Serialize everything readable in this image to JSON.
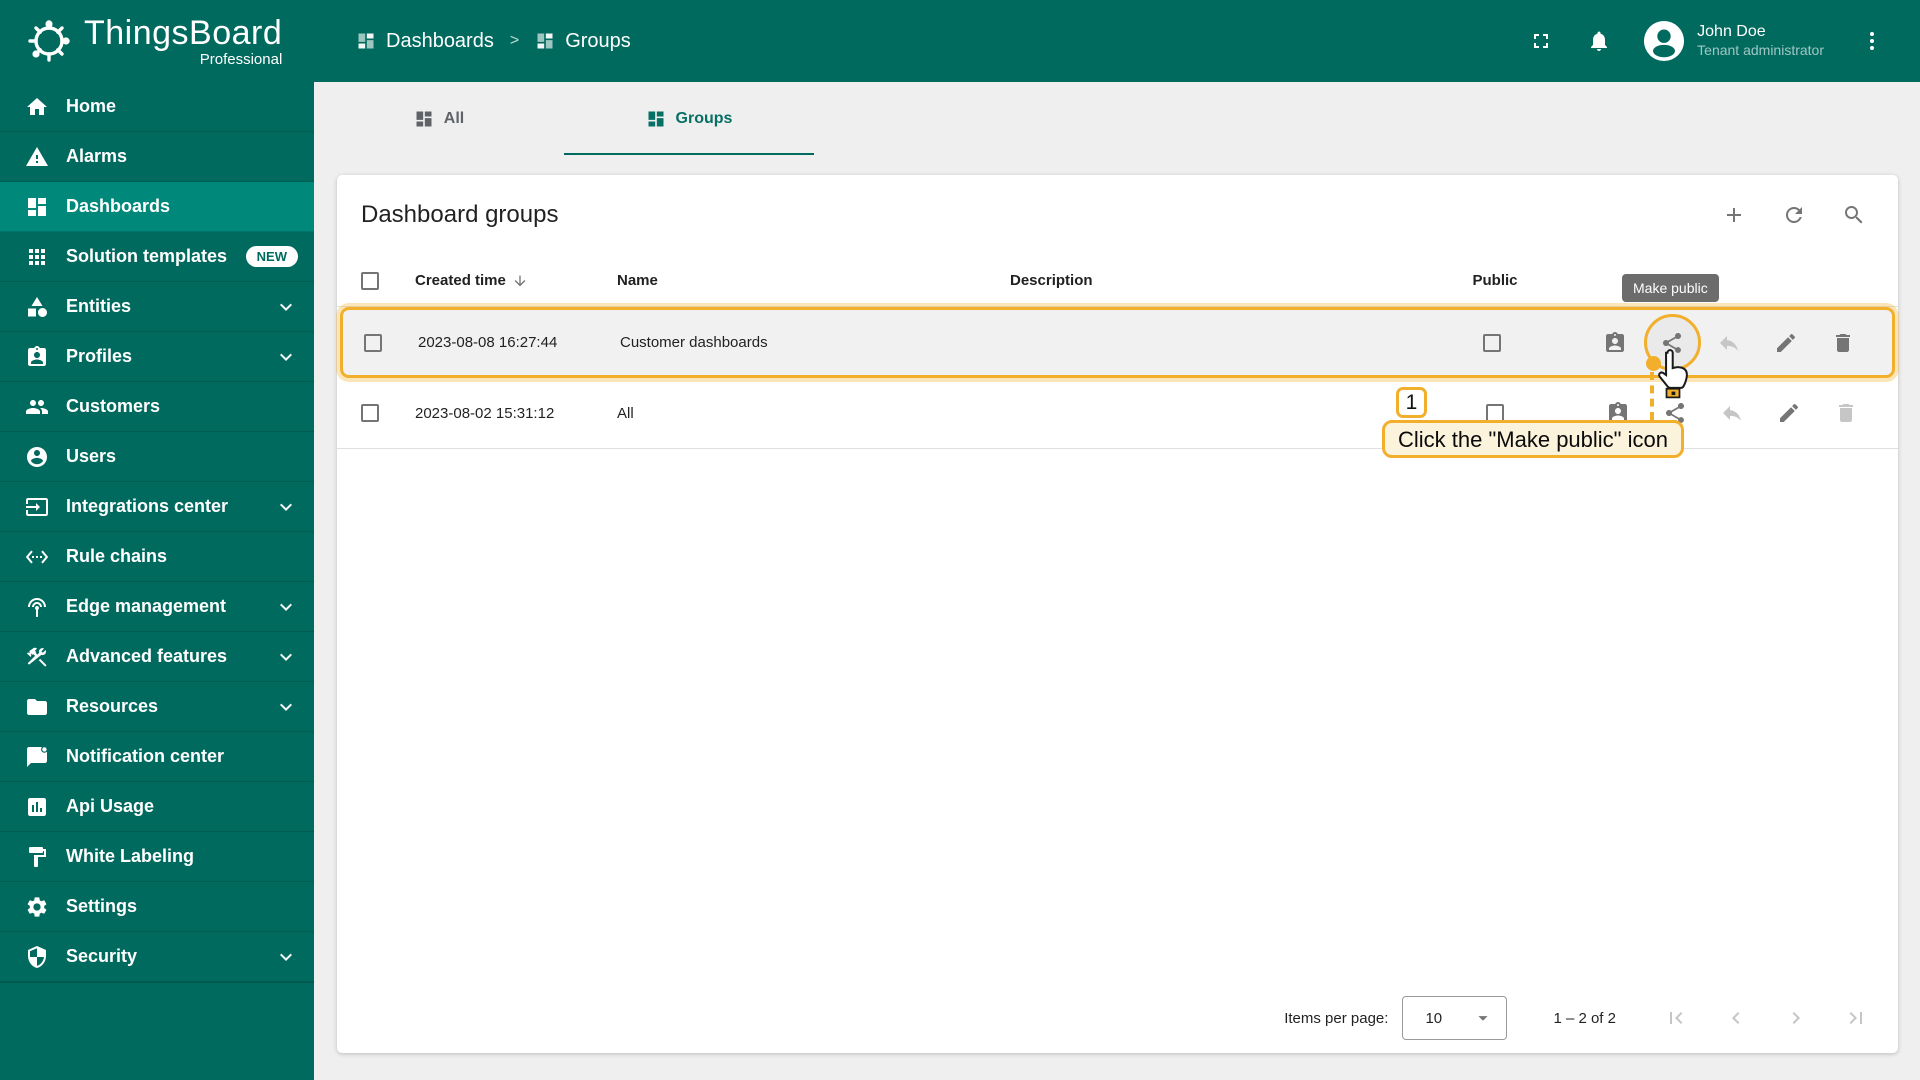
{
  "brand": {
    "name": "ThingsBoard",
    "subtitle": "Professional"
  },
  "breadcrumb": {
    "items": [
      {
        "label": "Dashboards"
      },
      {
        "label": "Groups"
      }
    ],
    "separator": ">"
  },
  "topbar": {
    "user": {
      "name": "John Doe",
      "role": "Tenant administrator"
    }
  },
  "sidebar": {
    "items": [
      {
        "label": "Home"
      },
      {
        "label": "Alarms"
      },
      {
        "label": "Dashboards",
        "selected": true
      },
      {
        "label": "Solution templates",
        "badge": "NEW"
      },
      {
        "label": "Entities",
        "expandable": true
      },
      {
        "label": "Profiles",
        "expandable": true
      },
      {
        "label": "Customers"
      },
      {
        "label": "Users"
      },
      {
        "label": "Integrations center",
        "expandable": true
      },
      {
        "label": "Rule chains"
      },
      {
        "label": "Edge management",
        "expandable": true
      },
      {
        "label": "Advanced features",
        "expandable": true
      },
      {
        "label": "Resources",
        "expandable": true
      },
      {
        "label": "Notification center"
      },
      {
        "label": "Api Usage"
      },
      {
        "label": "White Labeling"
      },
      {
        "label": "Settings"
      },
      {
        "label": "Security",
        "expandable": true
      }
    ]
  },
  "tabs": [
    {
      "label": "All",
      "active": false
    },
    {
      "label": "Groups",
      "active": true
    }
  ],
  "card": {
    "title": "Dashboard groups"
  },
  "table": {
    "headers": {
      "created": "Created time",
      "name": "Name",
      "description": "Description",
      "public": "Public"
    },
    "rows": [
      {
        "created": "2023-08-08 16:27:44",
        "name": "Customer dashboards",
        "description": "",
        "public_checked": false,
        "highlighted": true
      },
      {
        "created": "2023-08-02 15:31:12",
        "name": "All",
        "description": "",
        "public_checked": false,
        "highlighted": false
      }
    ]
  },
  "tooltip": {
    "text": "Make public"
  },
  "annotation": {
    "step": "1",
    "text": "Click the \"Make public\" icon"
  },
  "pagination": {
    "items_per_page_label": "Items per page:",
    "page_size": "10",
    "range": "1 – 2 of 2"
  },
  "colors": {
    "primary_green": "#016A5F",
    "selected_green": "#00897B",
    "accent_amber": "#F2AF2C",
    "tooltip_bg": "#646464",
    "callout_bg": "#FCF3DC",
    "row_highlight_bg": "#F1F1F1"
  }
}
